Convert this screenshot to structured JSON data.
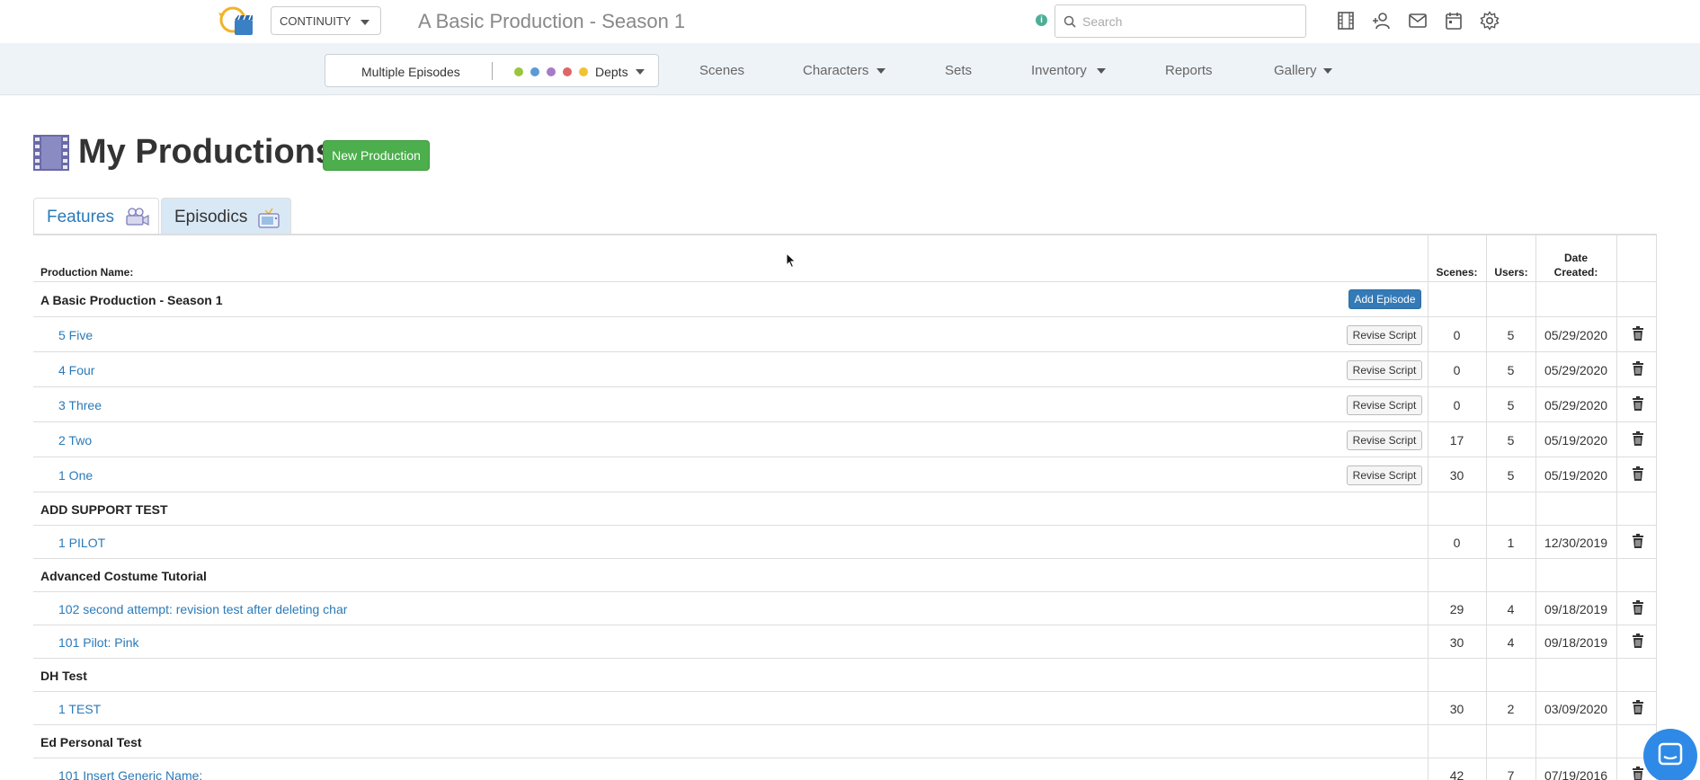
{
  "topbar": {
    "app_selector": "CONTINUITY",
    "production_title": "A Basic Production - Season 1",
    "info_label": "i",
    "search_placeholder": "Search",
    "icons": [
      "film-icon",
      "add-user-icon",
      "mail-icon",
      "calendar-icon",
      "gear-icon"
    ]
  },
  "nav": {
    "episodes_label": "Multiple Episodes",
    "depts_label": "Depts",
    "dept_colors": [
      "#9bc53d",
      "#5b9bd5",
      "#a67cc7",
      "#e06666",
      "#f1c232"
    ],
    "items": [
      {
        "label": "Scenes",
        "has_caret": false
      },
      {
        "label": "Characters",
        "has_caret": true
      },
      {
        "label": "Sets",
        "has_caret": false
      },
      {
        "label": "Inventory",
        "has_caret": true
      },
      {
        "label": "Reports",
        "has_caret": false
      },
      {
        "label": "Gallery",
        "has_caret": true
      }
    ]
  },
  "page": {
    "title": "My Productions",
    "new_production_label": "New Production"
  },
  "tabs": {
    "features": "Features",
    "episodics": "Episodics",
    "active": "Episodics"
  },
  "table": {
    "headers": {
      "name": "Production Name:",
      "scenes": "Scenes:",
      "users": "Users:",
      "date_line1": "Date",
      "date_line2": "Created:"
    },
    "add_episode_label": "Add Episode",
    "revise_label": "Revise Script",
    "rows": [
      {
        "type": "group",
        "name": "A Basic Production - Season 1",
        "add_episode": true
      },
      {
        "type": "episode",
        "name": "5 Five",
        "revise": true,
        "scenes": "0",
        "users": "5",
        "date": "05/29/2020"
      },
      {
        "type": "episode",
        "name": "4 Four",
        "revise": true,
        "scenes": "0",
        "users": "5",
        "date": "05/29/2020"
      },
      {
        "type": "episode",
        "name": "3 Three",
        "revise": true,
        "scenes": "0",
        "users": "5",
        "date": "05/29/2020"
      },
      {
        "type": "episode",
        "name": "2 Two",
        "revise": true,
        "scenes": "17",
        "users": "5",
        "date": "05/19/2020"
      },
      {
        "type": "episode",
        "name": "1 One",
        "revise": true,
        "scenes": "30",
        "users": "5",
        "date": "05/19/2020"
      },
      {
        "type": "group",
        "name": "ADD SUPPORT TEST"
      },
      {
        "type": "episode",
        "name": "1 PILOT",
        "scenes": "0",
        "users": "1",
        "date": "12/30/2019"
      },
      {
        "type": "group",
        "name": "Advanced Costume Tutorial"
      },
      {
        "type": "episode",
        "name": "102 second attempt: revision test after deleting char",
        "scenes": "29",
        "users": "4",
        "date": "09/18/2019"
      },
      {
        "type": "episode",
        "name": "101 Pilot: Pink",
        "scenes": "30",
        "users": "4",
        "date": "09/18/2019"
      },
      {
        "type": "group",
        "name": "DH Test"
      },
      {
        "type": "episode",
        "name": "1 TEST",
        "scenes": "30",
        "users": "2",
        "date": "03/09/2020"
      },
      {
        "type": "group",
        "name": "Ed Personal Test"
      },
      {
        "type": "episode",
        "name": "101 Insert Generic Name:",
        "scenes": "42",
        "users": "7",
        "date": "07/19/2016"
      }
    ]
  }
}
